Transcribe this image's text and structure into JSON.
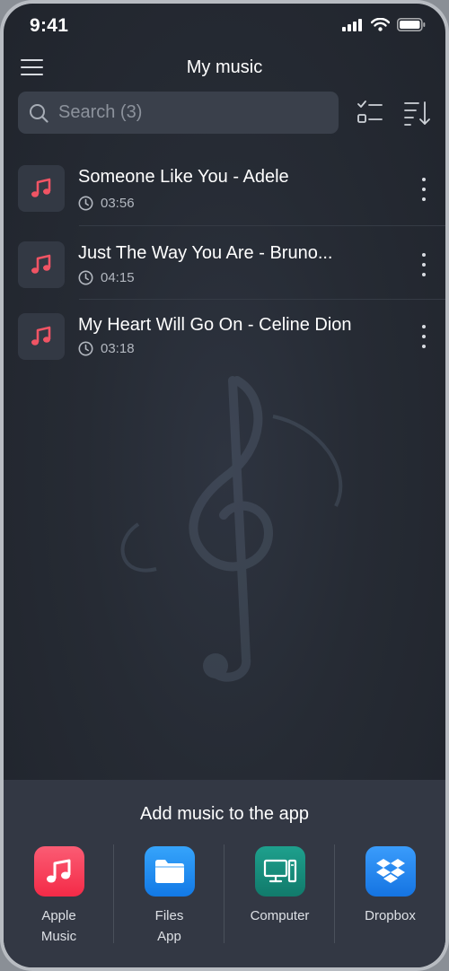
{
  "status_bar": {
    "time": "9:41"
  },
  "nav": {
    "title": "My music"
  },
  "search": {
    "placeholder": "Search (3)"
  },
  "songs": [
    {
      "title": "Someone Like You - Adele",
      "duration": "03:56"
    },
    {
      "title": "Just The Way You Are - Bruno...",
      "duration": "04:15"
    },
    {
      "title": "My Heart Will Go On - Celine Dion",
      "duration": "03:18"
    }
  ],
  "add_music": {
    "title": "Add music to the app",
    "sources": [
      {
        "label": "Apple\nMusic",
        "icon": "apple-music-icon",
        "color": "#f7485c"
      },
      {
        "label": "Files\nApp",
        "icon": "files-app-icon",
        "color": "#1f8ef1"
      },
      {
        "label": "Computer",
        "icon": "computer-icon",
        "color": "#17897a"
      },
      {
        "label": "Dropbox",
        "icon": "dropbox-icon",
        "color": "#1f86f2"
      }
    ]
  },
  "colors": {
    "accent_red": "#f05464",
    "background": "#262b34",
    "panel": "#333844"
  }
}
